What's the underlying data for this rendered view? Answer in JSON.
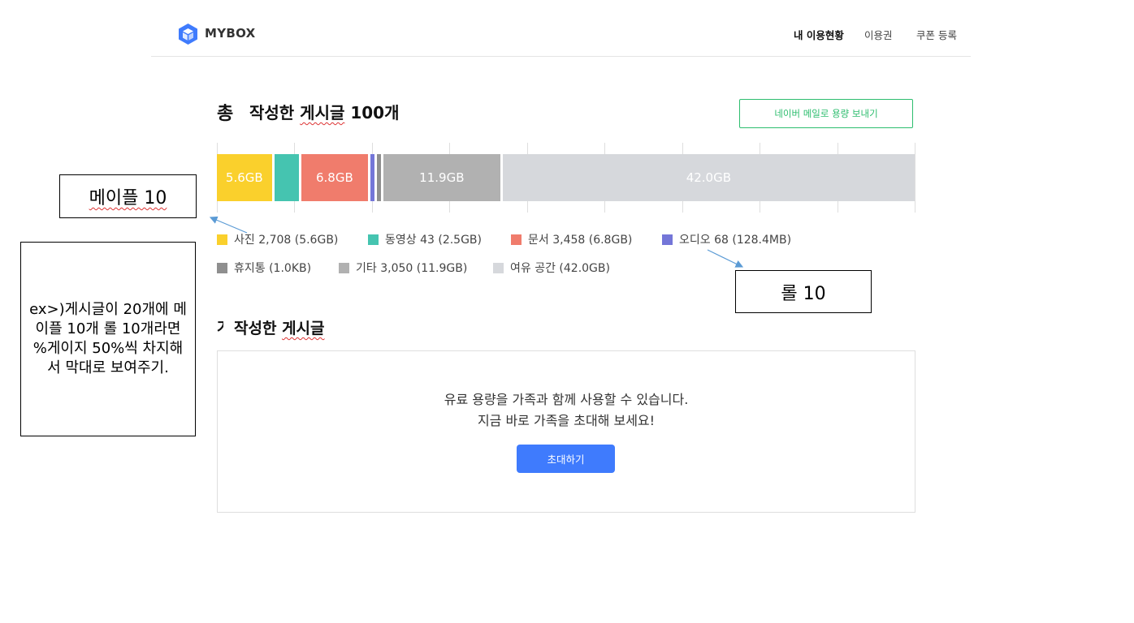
{
  "header": {
    "brand": "MYBOX",
    "nav": [
      "내 이용현황",
      "이용권",
      "쿠폰 등록"
    ]
  },
  "usage": {
    "title_prefix": "총",
    "title_part1": "작성한 ",
    "title_part2": "게시글",
    "title_part3": " 100개",
    "mail_button": "네이버 메일로 용량 보내기",
    "segments": [
      {
        "name": "사진",
        "value_gb": 5.6,
        "label": "5.6GB",
        "color": "#fad02c"
      },
      {
        "name": "동영상",
        "value_gb": 2.5,
        "label": "",
        "color": "#45c4b0"
      },
      {
        "name": "문서",
        "value_gb": 6.8,
        "label": "6.8GB",
        "color": "#f07c6c"
      },
      {
        "name": "오디오",
        "value_gb": 0.1284,
        "label": "",
        "color": "#7476d8"
      },
      {
        "name": "휴지통",
        "value_gb": 1e-06,
        "label": "",
        "color": "#8f8f8f"
      },
      {
        "name": "기타",
        "value_gb": 11.9,
        "label": "11.9GB",
        "color": "#b1b1b1"
      },
      {
        "name": "여유 공간",
        "value_gb": 42.0,
        "label": "42.0GB",
        "color": "#d6d8dc"
      }
    ],
    "legend": [
      {
        "text": "사진 2,708 (5.6GB)",
        "color": "#fad02c"
      },
      {
        "text": "동영상 43 (2.5GB)",
        "color": "#45c4b0"
      },
      {
        "text": "문서 3,458 (6.8GB)",
        "color": "#f07c6c"
      },
      {
        "text": "오디오 68 (128.4MB)",
        "color": "#7476d8"
      },
      {
        "text": "휴지통 (1.0KB)",
        "color": "#8f8f8f"
      },
      {
        "text": "기타 3,050 (11.9GB)",
        "color": "#b1b1b1"
      },
      {
        "text": "여유 공간 (42.0GB)",
        "color": "#d6d8dc"
      }
    ]
  },
  "section2": {
    "cut_char": "가",
    "title_part1": "작성한 ",
    "title_part2": "게시글"
  },
  "family": {
    "line1": "유료 용량을 가족과 함께 사용할 수 있습니다.",
    "line2": "지금 바로 가족을 초대해 보세요!",
    "invite_button": "초대하기"
  },
  "annotations": {
    "maple": "메이플 10",
    "roll": "롤 10",
    "example": "ex>)게시글이 20개에 메이플 10개 롤 10개라면 %게이지 50%씩 차지해서 막대로 보여주기."
  }
}
